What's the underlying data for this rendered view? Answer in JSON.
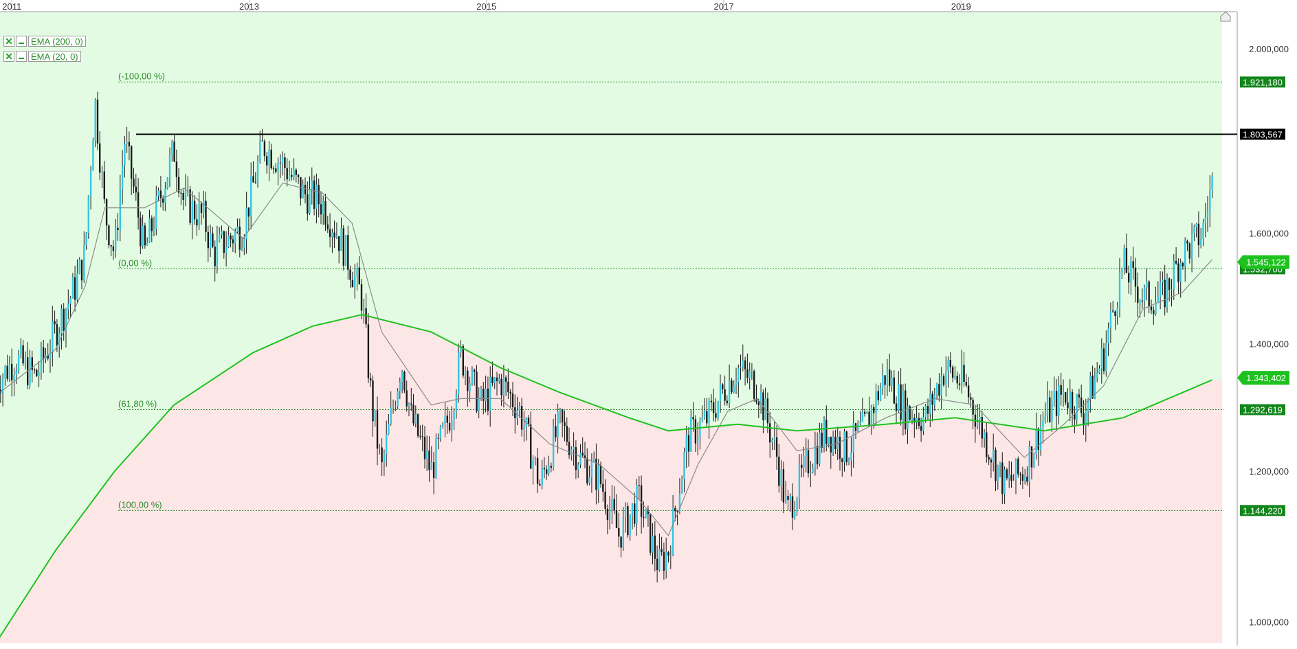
{
  "chart_data": {
    "type": "candlestick",
    "x_axis": {
      "ticks": [
        "2011",
        "2013",
        "2015",
        "2017",
        "2019"
      ]
    },
    "y_axis": {
      "ticks": [
        "1.000,000",
        "1.200,000",
        "1.400,000",
        "1.600,000",
        "2.000,000"
      ],
      "tick_values": [
        1000000,
        1200000,
        1400000,
        1600000,
        2000000
      ],
      "scale": "log",
      "ylim": [
        975000,
        2090000
      ]
    },
    "legend": [
      {
        "check": "✕",
        "label": "EMA (200, 0)"
      },
      {
        "check": "✕",
        "label": "EMA (20, 0)"
      }
    ],
    "fibonacci_levels": [
      {
        "label": "(-100,00 %)",
        "value": 1921180,
        "value_label": "1.921,180"
      },
      {
        "label": "(0,00 %)",
        "value": 1532700,
        "value_label": "1.532,700"
      },
      {
        "label": "(61,80 %)",
        "value": 1292619,
        "value_label": "1.292,619"
      },
      {
        "label": "(100,00 %)",
        "value": 1144220,
        "value_label": "1.144,220"
      }
    ],
    "horizontal_line": {
      "value": 1803567,
      "label": "1.803,567"
    },
    "ema_labels": [
      {
        "value": 1545122,
        "label": "1.545,122"
      },
      {
        "value": 1343402,
        "label": "1.343,402"
      }
    ],
    "price_path": [
      [
        "2010-12",
        1335000
      ],
      [
        "2011-02",
        1375000
      ],
      [
        "2011-04",
        1345000
      ],
      [
        "2011-06",
        1420000
      ],
      [
        "2011-08",
        1500000
      ],
      [
        "2011-09",
        1560000
      ],
      [
        "2011-10",
        1880000
      ],
      [
        "2011-11",
        1640000
      ],
      [
        "2011-12",
        1560000
      ],
      [
        "2012-01",
        1790000
      ],
      [
        "2012-02",
        1680000
      ],
      [
        "2012-03",
        1560000
      ],
      [
        "2012-05",
        1700000
      ],
      [
        "2012-06",
        1770000
      ],
      [
        "2012-07",
        1660000
      ],
      [
        "2012-09",
        1630000
      ],
      [
        "2012-10",
        1560000
      ],
      [
        "2012-11",
        1580000
      ],
      [
        "2013-01",
        1610000
      ],
      [
        "2013-03",
        1780000
      ],
      [
        "2013-05",
        1740000
      ],
      [
        "2013-07",
        1680000
      ],
      [
        "2013-09",
        1660000
      ],
      [
        "2013-11",
        1580000
      ],
      [
        "2014-01",
        1480000
      ],
      [
        "2014-02",
        1300000
      ],
      [
        "2014-03",
        1200000
      ],
      [
        "2014-05",
        1370000
      ],
      [
        "2014-06",
        1280000
      ],
      [
        "2014-08",
        1200000
      ],
      [
        "2014-10",
        1290000
      ],
      [
        "2014-11",
        1380000
      ],
      [
        "2015-01",
        1300000
      ],
      [
        "2015-03",
        1340000
      ],
      [
        "2015-05",
        1290000
      ],
      [
        "2015-07",
        1180000
      ],
      [
        "2015-09",
        1270000
      ],
      [
        "2015-11",
        1220000
      ],
      [
        "2016-01",
        1190000
      ],
      [
        "2016-03",
        1110000
      ],
      [
        "2016-05",
        1160000
      ],
      [
        "2016-07",
        1070000
      ],
      [
        "2016-08",
        1090000
      ],
      [
        "2016-10",
        1250000
      ],
      [
        "2016-12",
        1280000
      ],
      [
        "2017-03",
        1360000
      ],
      [
        "2017-05",
        1330000
      ],
      [
        "2017-07",
        1220000
      ],
      [
        "2017-08",
        1140000
      ],
      [
        "2017-10",
        1210000
      ],
      [
        "2017-12",
        1260000
      ],
      [
        "2018-02",
        1230000
      ],
      [
        "2018-04",
        1270000
      ],
      [
        "2018-06",
        1350000
      ],
      [
        "2018-08",
        1290000
      ],
      [
        "2018-10",
        1280000
      ],
      [
        "2018-12",
        1360000
      ],
      [
        "2019-02",
        1330000
      ],
      [
        "2019-04",
        1250000
      ],
      [
        "2019-06",
        1180000
      ],
      [
        "2019-08",
        1200000
      ],
      [
        "2019-10",
        1280000
      ],
      [
        "2019-12",
        1320000
      ],
      [
        "2020-02",
        1290000
      ],
      [
        "2020-04",
        1380000
      ],
      [
        "2020-06",
        1540000
      ],
      [
        "2020-08",
        1480000
      ],
      [
        "2020-10",
        1480000
      ],
      [
        "2020-12",
        1560000
      ],
      [
        "2021-02",
        1600000
      ],
      [
        "2021-03",
        1700000
      ]
    ],
    "ema20_path": [
      [
        "2010-12",
        1315000
      ],
      [
        "2011-06",
        1390000
      ],
      [
        "2011-09",
        1500000
      ],
      [
        "2011-11",
        1650000
      ],
      [
        "2012-03",
        1650000
      ],
      [
        "2012-07",
        1690000
      ],
      [
        "2012-10",
        1640000
      ],
      [
        "2013-01",
        1590000
      ],
      [
        "2013-05",
        1700000
      ],
      [
        "2013-09",
        1680000
      ],
      [
        "2013-12",
        1620000
      ],
      [
        "2014-03",
        1420000
      ],
      [
        "2014-08",
        1300000
      ],
      [
        "2014-11",
        1310000
      ],
      [
        "2015-03",
        1310000
      ],
      [
        "2015-08",
        1240000
      ],
      [
        "2016-01",
        1210000
      ],
      [
        "2016-05",
        1160000
      ],
      [
        "2016-08",
        1110000
      ],
      [
        "2016-11",
        1210000
      ],
      [
        "2017-02",
        1290000
      ],
      [
        "2017-05",
        1310000
      ],
      [
        "2017-09",
        1230000
      ],
      [
        "2018-01",
        1240000
      ],
      [
        "2018-06",
        1280000
      ],
      [
        "2018-11",
        1310000
      ],
      [
        "2019-03",
        1300000
      ],
      [
        "2019-08",
        1220000
      ],
      [
        "2019-12",
        1270000
      ],
      [
        "2020-04",
        1330000
      ],
      [
        "2020-08",
        1460000
      ],
      [
        "2020-12",
        1490000
      ],
      [
        "2021-03",
        1550000
      ]
    ],
    "ema200_path": [
      [
        "2010-12",
        975000
      ],
      [
        "2011-06",
        1090000
      ],
      [
        "2011-12",
        1200000
      ],
      [
        "2012-06",
        1300000
      ],
      [
        "2013-02",
        1385000
      ],
      [
        "2013-08",
        1430000
      ],
      [
        "2014-01",
        1450000
      ],
      [
        "2014-08",
        1420000
      ],
      [
        "2015-03",
        1360000
      ],
      [
        "2015-09",
        1320000
      ],
      [
        "2016-04",
        1280000
      ],
      [
        "2016-08",
        1260000
      ],
      [
        "2017-03",
        1270000
      ],
      [
        "2017-09",
        1260000
      ],
      [
        "2018-06",
        1270000
      ],
      [
        "2019-01",
        1280000
      ],
      [
        "2019-10",
        1260000
      ],
      [
        "2020-06",
        1280000
      ],
      [
        "2021-03",
        1340000
      ]
    ]
  },
  "colors": {
    "bull": "#35c5e0",
    "bear": "#1a1a1a",
    "ema": "#1fc21f",
    "ema_fast": "#8a8a8a",
    "bg_upper": "#e3fbe3",
    "bg_lower": "#fde6e6",
    "fib_line": "#1e8c1e",
    "fib_label_bg": "#13861b",
    "fib_text": "#2b8a2b",
    "hline": "#000000"
  }
}
